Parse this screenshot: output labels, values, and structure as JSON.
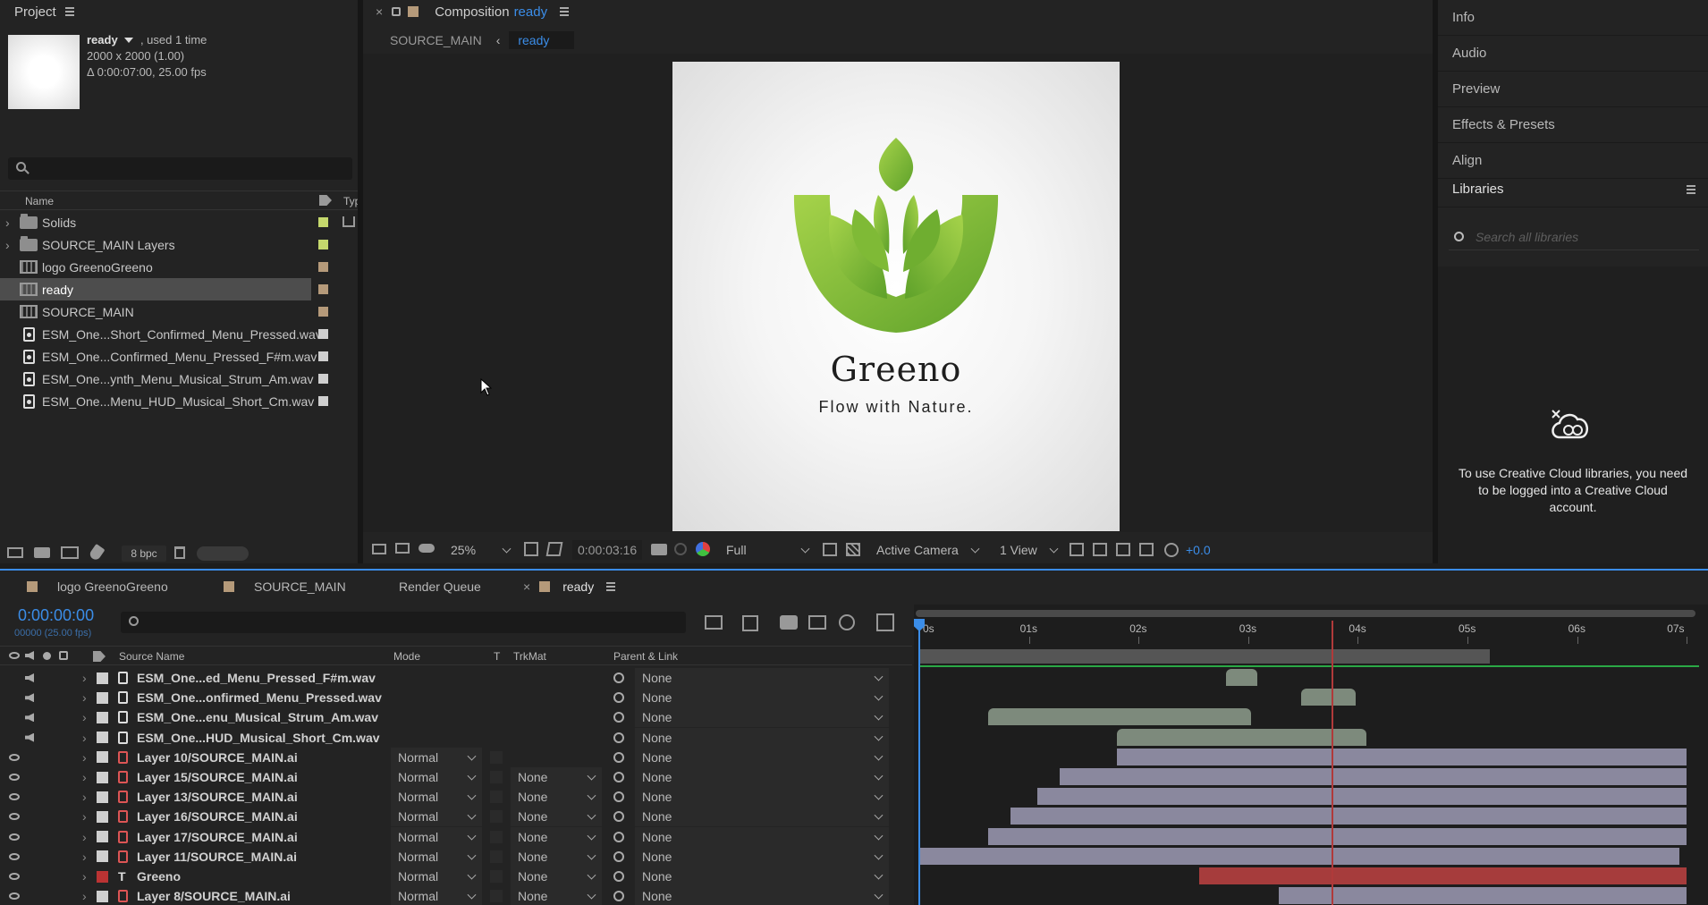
{
  "project": {
    "title": "Project",
    "comp_name": "ready",
    "used": ", used 1 time",
    "dims": "2000 x 2000 (1.00)",
    "duration": "Δ 0:00:07:00, 25.00 fps",
    "col_name": "Name",
    "col_type": "Typ",
    "bpc": "8 bpc",
    "items": [
      {
        "label": "Solids",
        "type": "folder",
        "color": "#c5d86d"
      },
      {
        "label": "SOURCE_MAIN Layers",
        "type": "folder",
        "color": "#c5d86d"
      },
      {
        "label": "logo GreenoGreeno",
        "type": "comp",
        "color": "#b59a7a"
      },
      {
        "label": "ready",
        "type": "comp",
        "color": "#b59a7a"
      },
      {
        "label": "SOURCE_MAIN",
        "type": "comp",
        "color": "#b59a7a"
      },
      {
        "label": "ESM_One...Short_Confirmed_Menu_Pressed.wav",
        "type": "audio",
        "color": "#cfcfcf"
      },
      {
        "label": "ESM_One...Confirmed_Menu_Pressed_F#m.wav",
        "type": "audio",
        "color": "#cfcfcf"
      },
      {
        "label": "ESM_One...ynth_Menu_Musical_Strum_Am.wav",
        "type": "audio",
        "color": "#cfcfcf"
      },
      {
        "label": "ESM_One...Menu_HUD_Musical_Short_Cm.wav",
        "type": "audio",
        "color": "#cfcfcf"
      }
    ]
  },
  "composition": {
    "label": "Composition",
    "name": "ready",
    "breadcrumb_parent": "SOURCE_MAIN",
    "breadcrumb_current": "ready",
    "logo_title": "Greeno",
    "logo_tagline": "Flow with Nature.",
    "zoom": "25%",
    "timecode": "0:00:03:16",
    "resolution": "Full",
    "camera": "Active Camera",
    "views": "1 View",
    "exposure": "+0.0"
  },
  "right_panel": {
    "items": [
      "Info",
      "Audio",
      "Preview",
      "Effects & Presets",
      "Align"
    ],
    "libraries_title": "Libraries",
    "search_placeholder": "Search all libraries",
    "message": "To use Creative Cloud libraries, you need to be logged into a Creative Cloud account."
  },
  "timeline": {
    "tabs": [
      "logo GreenoGreeno",
      "SOURCE_MAIN",
      "Render Queue",
      "ready"
    ],
    "timecode": "0:00:00:00",
    "frame_info": "00000 (25.00 fps)",
    "col_source": "Source Name",
    "col_mode": "Mode",
    "col_t": "T",
    "col_trkmat": "TrkMat",
    "col_parent": "Parent & Link",
    "ruler": [
      "0s",
      "01s",
      "02s",
      "03s",
      "04s",
      "05s",
      "06s",
      "07s"
    ],
    "layers": [
      {
        "name": "ESM_One...ed_Menu_Pressed_F#m.wav",
        "kind": "audio",
        "mode": "",
        "trkmat": "",
        "parent": "None",
        "start": 2.8,
        "end": 3.08,
        "bar": "#7d8a7c"
      },
      {
        "name": "ESM_One...onfirmed_Menu_Pressed.wav",
        "kind": "audio",
        "mode": "",
        "trkmat": "",
        "parent": "None",
        "start": 3.48,
        "end": 3.98,
        "bar": "#7d8a7c"
      },
      {
        "name": "ESM_One...enu_Musical_Strum_Am.wav",
        "kind": "audio",
        "mode": "",
        "trkmat": "",
        "parent": "None",
        "start": 0.63,
        "end": 3.03,
        "bar": "#7d8a7c"
      },
      {
        "name": "ESM_One...HUD_Musical_Short_Cm.wav",
        "kind": "audio",
        "mode": "",
        "trkmat": "",
        "parent": "None",
        "start": 1.8,
        "end": 4.08,
        "bar": "#7d8a7c"
      },
      {
        "name": "Layer 10/SOURCE_MAIN.ai",
        "kind": "ai",
        "mode": "Normal",
        "trkmat": "",
        "parent": "None",
        "start": 1.8,
        "end": 7.0,
        "bar": "#8a889e"
      },
      {
        "name": "Layer 15/SOURCE_MAIN.ai",
        "kind": "ai",
        "mode": "Normal",
        "trkmat": "None",
        "parent": "None",
        "start": 1.28,
        "end": 7.0,
        "bar": "#8a889e"
      },
      {
        "name": "Layer 13/SOURCE_MAIN.ai",
        "kind": "ai",
        "mode": "Normal",
        "trkmat": "None",
        "parent": "None",
        "start": 1.08,
        "end": 7.0,
        "bar": "#8a889e"
      },
      {
        "name": "Layer 16/SOURCE_MAIN.ai",
        "kind": "ai",
        "mode": "Normal",
        "trkmat": "None",
        "parent": "None",
        "start": 0.83,
        "end": 7.0,
        "bar": "#8a889e"
      },
      {
        "name": "Layer 17/SOURCE_MAIN.ai",
        "kind": "ai",
        "mode": "Normal",
        "trkmat": "None",
        "parent": "None",
        "start": 0.63,
        "end": 7.0,
        "bar": "#8a889e"
      },
      {
        "name": "Layer 11/SOURCE_MAIN.ai",
        "kind": "ai",
        "mode": "Normal",
        "trkmat": "None",
        "parent": "None",
        "start": 0.0,
        "end": 6.93,
        "bar": "#8a889e"
      },
      {
        "name": "Greeno",
        "kind": "text",
        "mode": "Normal",
        "trkmat": "None",
        "parent": "None",
        "start": 2.55,
        "end": 7.0,
        "bar": "#a63c3c"
      },
      {
        "name": "Layer 8/SOURCE_MAIN.ai",
        "kind": "ai",
        "mode": "Normal",
        "trkmat": "None",
        "parent": "None",
        "start": 3.28,
        "end": 7.0,
        "bar": "#8a889e"
      }
    ],
    "work_area_end": 5.2,
    "current_time_marker": 3.76
  },
  "colors": {
    "accent": "#3b8de8",
    "green": "#8dc63f"
  }
}
